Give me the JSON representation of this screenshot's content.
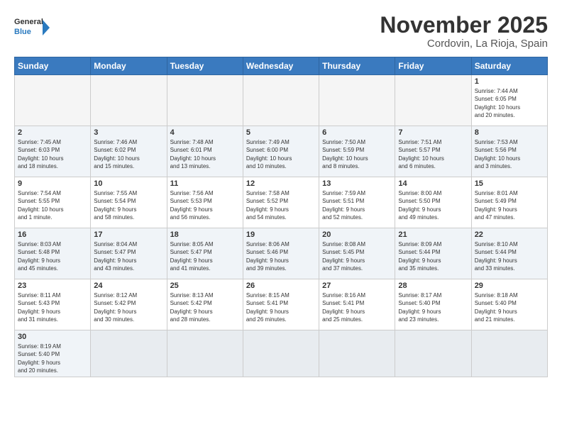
{
  "header": {
    "logo_general": "General",
    "logo_blue": "Blue",
    "month_year": "November 2025",
    "location": "Cordovin, La Rioja, Spain"
  },
  "weekdays": [
    "Sunday",
    "Monday",
    "Tuesday",
    "Wednesday",
    "Thursday",
    "Friday",
    "Saturday"
  ],
  "weeks": [
    [
      {
        "day": "",
        "info": ""
      },
      {
        "day": "",
        "info": ""
      },
      {
        "day": "",
        "info": ""
      },
      {
        "day": "",
        "info": ""
      },
      {
        "day": "",
        "info": ""
      },
      {
        "day": "",
        "info": ""
      },
      {
        "day": "1",
        "info": "Sunrise: 7:44 AM\nSunset: 6:05 PM\nDaylight: 10 hours\nand 20 minutes."
      }
    ],
    [
      {
        "day": "2",
        "info": "Sunrise: 7:45 AM\nSunset: 6:03 PM\nDaylight: 10 hours\nand 18 minutes."
      },
      {
        "day": "3",
        "info": "Sunrise: 7:46 AM\nSunset: 6:02 PM\nDaylight: 10 hours\nand 15 minutes."
      },
      {
        "day": "4",
        "info": "Sunrise: 7:48 AM\nSunset: 6:01 PM\nDaylight: 10 hours\nand 13 minutes."
      },
      {
        "day": "5",
        "info": "Sunrise: 7:49 AM\nSunset: 6:00 PM\nDaylight: 10 hours\nand 10 minutes."
      },
      {
        "day": "6",
        "info": "Sunrise: 7:50 AM\nSunset: 5:59 PM\nDaylight: 10 hours\nand 8 minutes."
      },
      {
        "day": "7",
        "info": "Sunrise: 7:51 AM\nSunset: 5:57 PM\nDaylight: 10 hours\nand 6 minutes."
      },
      {
        "day": "8",
        "info": "Sunrise: 7:53 AM\nSunset: 5:56 PM\nDaylight: 10 hours\nand 3 minutes."
      }
    ],
    [
      {
        "day": "9",
        "info": "Sunrise: 7:54 AM\nSunset: 5:55 PM\nDaylight: 10 hours\nand 1 minute."
      },
      {
        "day": "10",
        "info": "Sunrise: 7:55 AM\nSunset: 5:54 PM\nDaylight: 9 hours\nand 58 minutes."
      },
      {
        "day": "11",
        "info": "Sunrise: 7:56 AM\nSunset: 5:53 PM\nDaylight: 9 hours\nand 56 minutes."
      },
      {
        "day": "12",
        "info": "Sunrise: 7:58 AM\nSunset: 5:52 PM\nDaylight: 9 hours\nand 54 minutes."
      },
      {
        "day": "13",
        "info": "Sunrise: 7:59 AM\nSunset: 5:51 PM\nDaylight: 9 hours\nand 52 minutes."
      },
      {
        "day": "14",
        "info": "Sunrise: 8:00 AM\nSunset: 5:50 PM\nDaylight: 9 hours\nand 49 minutes."
      },
      {
        "day": "15",
        "info": "Sunrise: 8:01 AM\nSunset: 5:49 PM\nDaylight: 9 hours\nand 47 minutes."
      }
    ],
    [
      {
        "day": "16",
        "info": "Sunrise: 8:03 AM\nSunset: 5:48 PM\nDaylight: 9 hours\nand 45 minutes."
      },
      {
        "day": "17",
        "info": "Sunrise: 8:04 AM\nSunset: 5:47 PM\nDaylight: 9 hours\nand 43 minutes."
      },
      {
        "day": "18",
        "info": "Sunrise: 8:05 AM\nSunset: 5:47 PM\nDaylight: 9 hours\nand 41 minutes."
      },
      {
        "day": "19",
        "info": "Sunrise: 8:06 AM\nSunset: 5:46 PM\nDaylight: 9 hours\nand 39 minutes."
      },
      {
        "day": "20",
        "info": "Sunrise: 8:08 AM\nSunset: 5:45 PM\nDaylight: 9 hours\nand 37 minutes."
      },
      {
        "day": "21",
        "info": "Sunrise: 8:09 AM\nSunset: 5:44 PM\nDaylight: 9 hours\nand 35 minutes."
      },
      {
        "day": "22",
        "info": "Sunrise: 8:10 AM\nSunset: 5:44 PM\nDaylight: 9 hours\nand 33 minutes."
      }
    ],
    [
      {
        "day": "23",
        "info": "Sunrise: 8:11 AM\nSunset: 5:43 PM\nDaylight: 9 hours\nand 31 minutes."
      },
      {
        "day": "24",
        "info": "Sunrise: 8:12 AM\nSunset: 5:42 PM\nDaylight: 9 hours\nand 30 minutes."
      },
      {
        "day": "25",
        "info": "Sunrise: 8:13 AM\nSunset: 5:42 PM\nDaylight: 9 hours\nand 28 minutes."
      },
      {
        "day": "26",
        "info": "Sunrise: 8:15 AM\nSunset: 5:41 PM\nDaylight: 9 hours\nand 26 minutes."
      },
      {
        "day": "27",
        "info": "Sunrise: 8:16 AM\nSunset: 5:41 PM\nDaylight: 9 hours\nand 25 minutes."
      },
      {
        "day": "28",
        "info": "Sunrise: 8:17 AM\nSunset: 5:40 PM\nDaylight: 9 hours\nand 23 minutes."
      },
      {
        "day": "29",
        "info": "Sunrise: 8:18 AM\nSunset: 5:40 PM\nDaylight: 9 hours\nand 21 minutes."
      }
    ],
    [
      {
        "day": "30",
        "info": "Sunrise: 8:19 AM\nSunset: 5:40 PM\nDaylight: 9 hours\nand 20 minutes."
      },
      {
        "day": "",
        "info": ""
      },
      {
        "day": "",
        "info": ""
      },
      {
        "day": "",
        "info": ""
      },
      {
        "day": "",
        "info": ""
      },
      {
        "day": "",
        "info": ""
      },
      {
        "day": "",
        "info": ""
      }
    ]
  ]
}
